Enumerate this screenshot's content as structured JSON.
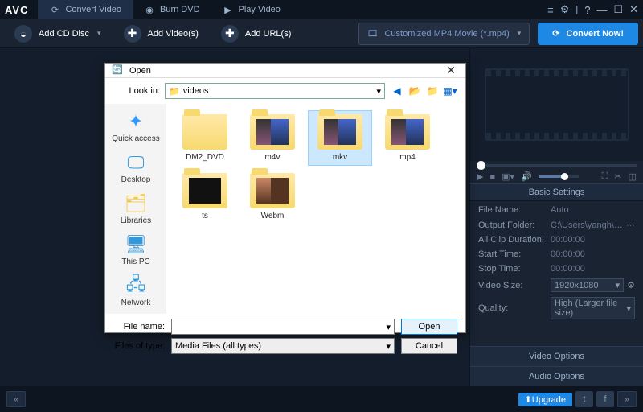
{
  "titlebar": {
    "logo": "AVC",
    "tabs": [
      {
        "label": "Convert Video"
      },
      {
        "label": "Burn DVD"
      },
      {
        "label": "Play Video"
      }
    ]
  },
  "toolbar": {
    "add_cd": "Add CD Disc",
    "add_videos": "Add Video(s)",
    "add_urls": "Add URL(s)",
    "format": "Customized MP4 Movie (*.mp4)",
    "convert": "Convert Now!"
  },
  "settings": {
    "header": "Basic Settings",
    "rows": [
      {
        "lbl": "File Name:",
        "val": "Auto"
      },
      {
        "lbl": "Output Folder:",
        "val": "C:\\Users\\yangh\\Videos..."
      },
      {
        "lbl": "All Clip Duration:",
        "val": "00:00:00"
      },
      {
        "lbl": "Start Time:",
        "val": "00:00:00"
      },
      {
        "lbl": "Stop Time:",
        "val": "00:00:00"
      }
    ],
    "video_size_lbl": "Video Size:",
    "video_size": "1920x1080",
    "quality_lbl": "Quality:",
    "quality": "High (Larger file size)",
    "video_options": "Video Options",
    "audio_options": "Audio Options"
  },
  "footer": {
    "upgrade": "Upgrade"
  },
  "dialog": {
    "title": "Open",
    "lookin_lbl": "Look in:",
    "lookin_val": "videos",
    "places": [
      {
        "lbl": "Quick access"
      },
      {
        "lbl": "Desktop"
      },
      {
        "lbl": "Libraries"
      },
      {
        "lbl": "This PC"
      },
      {
        "lbl": "Network"
      }
    ],
    "files": [
      {
        "lbl": "DM2_DVD"
      },
      {
        "lbl": "m4v"
      },
      {
        "lbl": "mkv",
        "sel": true
      },
      {
        "lbl": "mp4"
      },
      {
        "lbl": "ts"
      },
      {
        "lbl": "Webm"
      }
    ],
    "filename_lbl": "File name:",
    "filename_val": "",
    "filetype_lbl": "Files of type:",
    "filetype_val": "Media Files (all types)",
    "open_btn": "Open",
    "cancel_btn": "Cancel"
  }
}
